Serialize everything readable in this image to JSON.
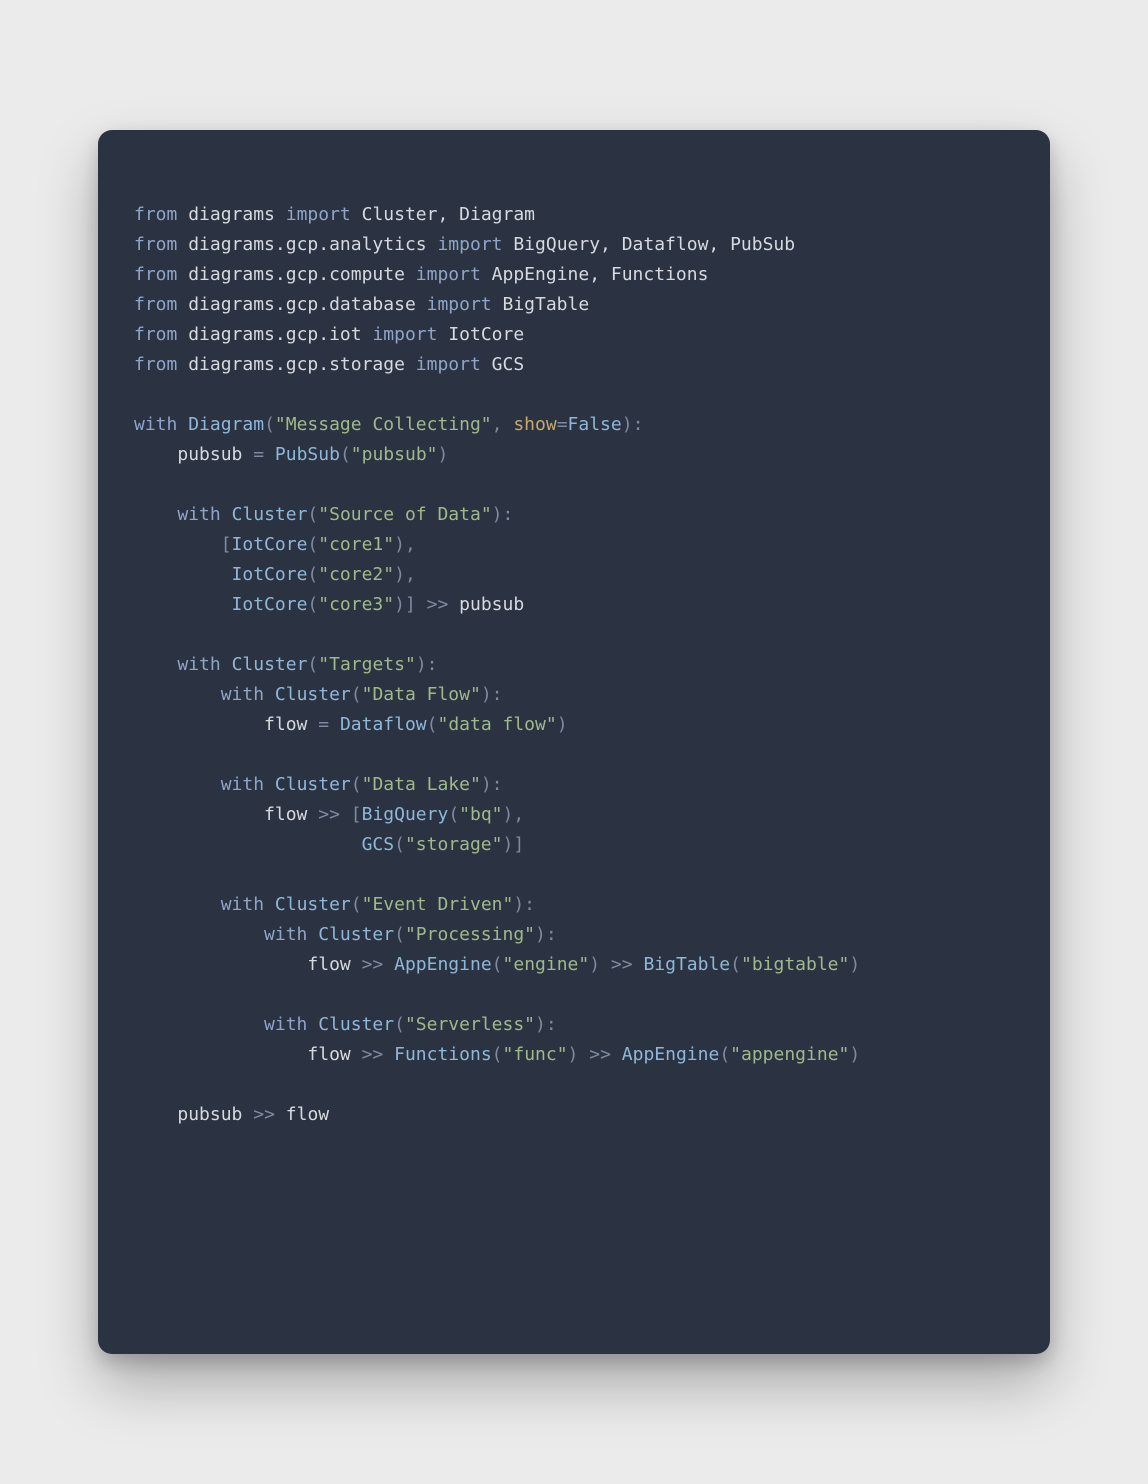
{
  "code": {
    "imports": [
      {
        "module": "diagrams",
        "names": "Cluster, Diagram"
      },
      {
        "module": "diagrams.gcp.analytics",
        "names": "BigQuery, Dataflow, PubSub"
      },
      {
        "module": "diagrams.gcp.compute",
        "names": "AppEngine, Functions"
      },
      {
        "module": "diagrams.gcp.database",
        "names": "BigTable"
      },
      {
        "module": "diagrams.gcp.iot",
        "names": "IotCore"
      },
      {
        "module": "diagrams.gcp.storage",
        "names": "GCS"
      }
    ],
    "diagram": {
      "ctor": "Diagram",
      "title": "\"Message Collecting\"",
      "kwarg_name": "show",
      "kwarg_val": "False"
    },
    "pubsub": {
      "var": "pubsub",
      "ctor": "PubSub",
      "arg": "\"pubsub\""
    },
    "cluster_source": {
      "ctor": "Cluster",
      "label": "\"Source of Data\"",
      "iot_ctor": "IotCore",
      "iot_args": [
        "\"core1\"",
        "\"core2\"",
        "\"core3\""
      ],
      "to": "pubsub"
    },
    "cluster_targets": {
      "ctor": "Cluster",
      "label": "\"Targets\"",
      "dataflow": {
        "cluster_ctor": "Cluster",
        "cluster_label": "\"Data Flow\"",
        "var": "flow",
        "ctor": "Dataflow",
        "arg": "\"data flow\""
      },
      "datalake": {
        "cluster_ctor": "Cluster",
        "cluster_label": "\"Data Lake\"",
        "from": "flow",
        "bq_ctor": "BigQuery",
        "bq_arg": "\"bq\"",
        "gcs_ctor": "GCS",
        "gcs_arg": "\"storage\""
      },
      "event_driven": {
        "cluster_ctor": "Cluster",
        "cluster_label": "\"Event Driven\"",
        "processing": {
          "cluster_ctor": "Cluster",
          "cluster_label": "\"Processing\"",
          "from": "flow",
          "app_ctor": "AppEngine",
          "app_arg": "\"engine\"",
          "bt_ctor": "BigTable",
          "bt_arg": "\"bigtable\""
        },
        "serverless": {
          "cluster_ctor": "Cluster",
          "cluster_label": "\"Serverless\"",
          "from": "flow",
          "fn_ctor": "Functions",
          "fn_arg": "\"func\"",
          "app_ctor": "AppEngine",
          "app_arg": "\"appengine\""
        }
      }
    },
    "tail": {
      "left": "pubsub",
      "op": ">>",
      "right": "flow"
    }
  }
}
